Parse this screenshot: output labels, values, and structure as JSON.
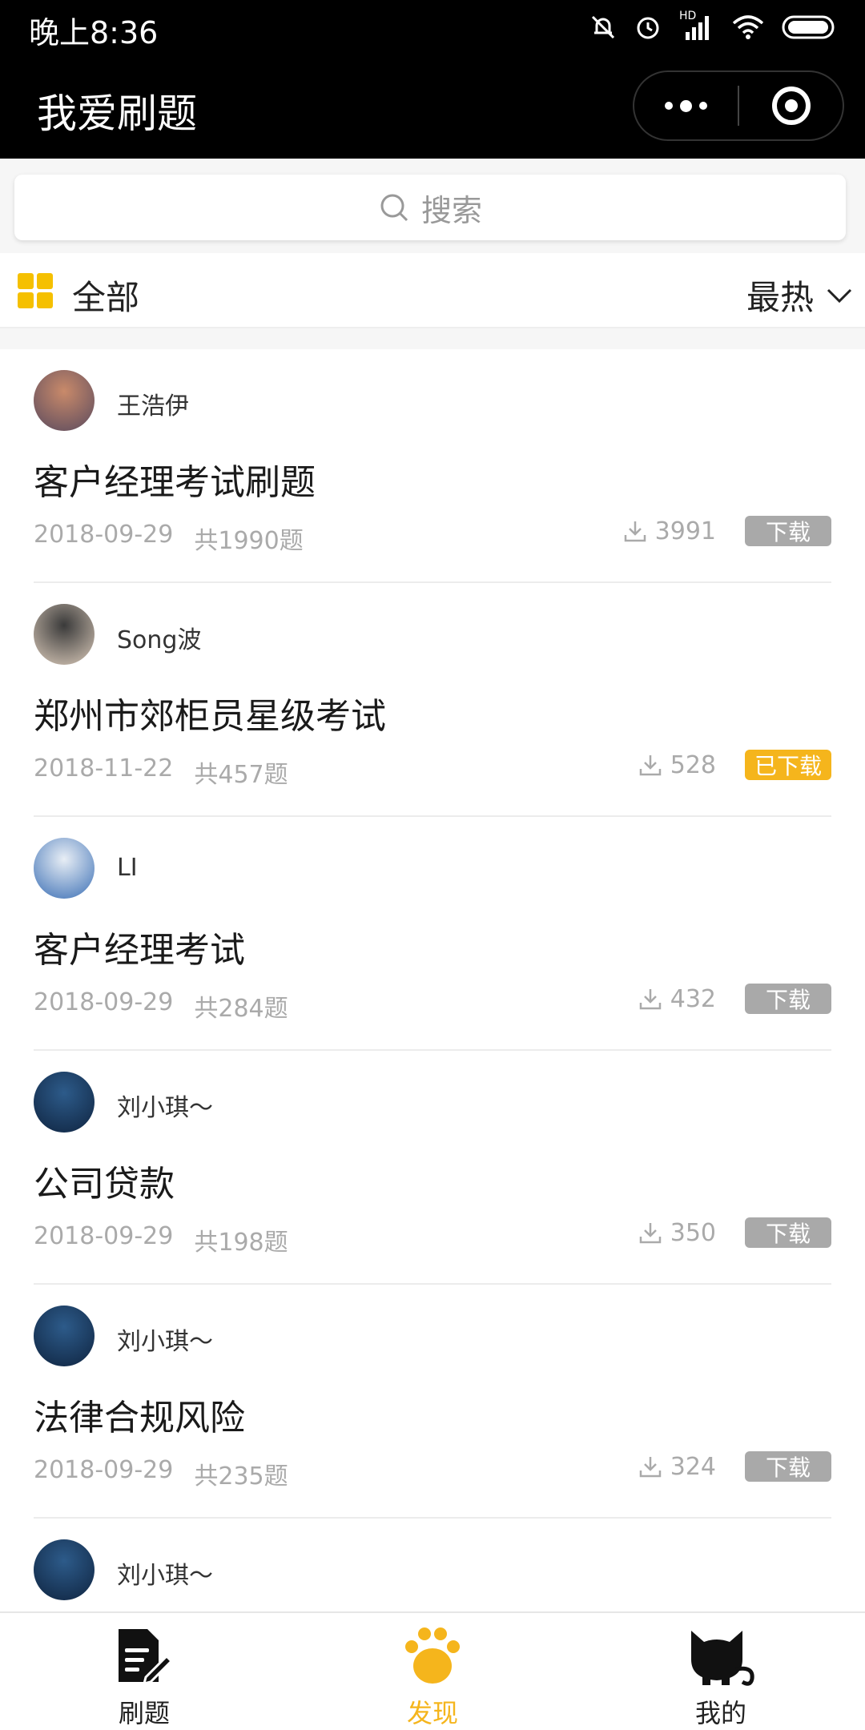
{
  "status_bar": {
    "time": "晚上8:36",
    "hd_label": "HD"
  },
  "nav": {
    "title": "我爱刷题"
  },
  "search": {
    "placeholder": "搜索"
  },
  "filter": {
    "category": "全部",
    "sort": "最热"
  },
  "items": [
    {
      "author": "王浩伊",
      "title": "客户经理考试刷题",
      "date": "2018-09-29",
      "count": "共1990题",
      "downloads": "3991",
      "badge": "下载",
      "downloaded": false,
      "avatar_colors": [
        "#c98a6a",
        "#5a4a5e"
      ]
    },
    {
      "author": "Song波",
      "title": "郑州市郊柜员星级考试",
      "date": "2018-11-22",
      "count": "共457题",
      "downloads": "528",
      "badge": "已下载",
      "downloaded": true,
      "avatar_colors": [
        "#3a3a3a",
        "#d9c9b9"
      ]
    },
    {
      "author": "LI",
      "title": "客户经理考试",
      "date": "2018-09-29",
      "count": "共284题",
      "downloads": "432",
      "badge": "下载",
      "downloaded": false,
      "avatar_colors": [
        "#e8eef5",
        "#3b6fb5"
      ]
    },
    {
      "author": "刘小琪～",
      "title": "公司贷款",
      "date": "2018-09-29",
      "count": "共198题",
      "downloads": "350",
      "badge": "下载",
      "downloaded": false,
      "avatar_colors": [
        "#2d5b8a",
        "#0f2440"
      ]
    },
    {
      "author": "刘小琪～",
      "title": "法律合规风险",
      "date": "2018-09-29",
      "count": "共235题",
      "downloads": "324",
      "badge": "下载",
      "downloaded": false,
      "avatar_colors": [
        "#2d5b8a",
        "#0f2440"
      ]
    },
    {
      "author": "刘小琪～",
      "title": "",
      "date": "",
      "count": "",
      "downloads": "",
      "badge": "",
      "downloaded": false,
      "avatar_colors": [
        "#2d5b8a",
        "#0f2440"
      ]
    }
  ],
  "tabs": [
    {
      "label": "刷题",
      "active": false
    },
    {
      "label": "发现",
      "active": true
    },
    {
      "label": "我的",
      "active": false
    }
  ],
  "colors": {
    "accent": "#f5b51c",
    "badge_gray": "#a9a9a9",
    "grid_yellow": "#f5c000"
  }
}
